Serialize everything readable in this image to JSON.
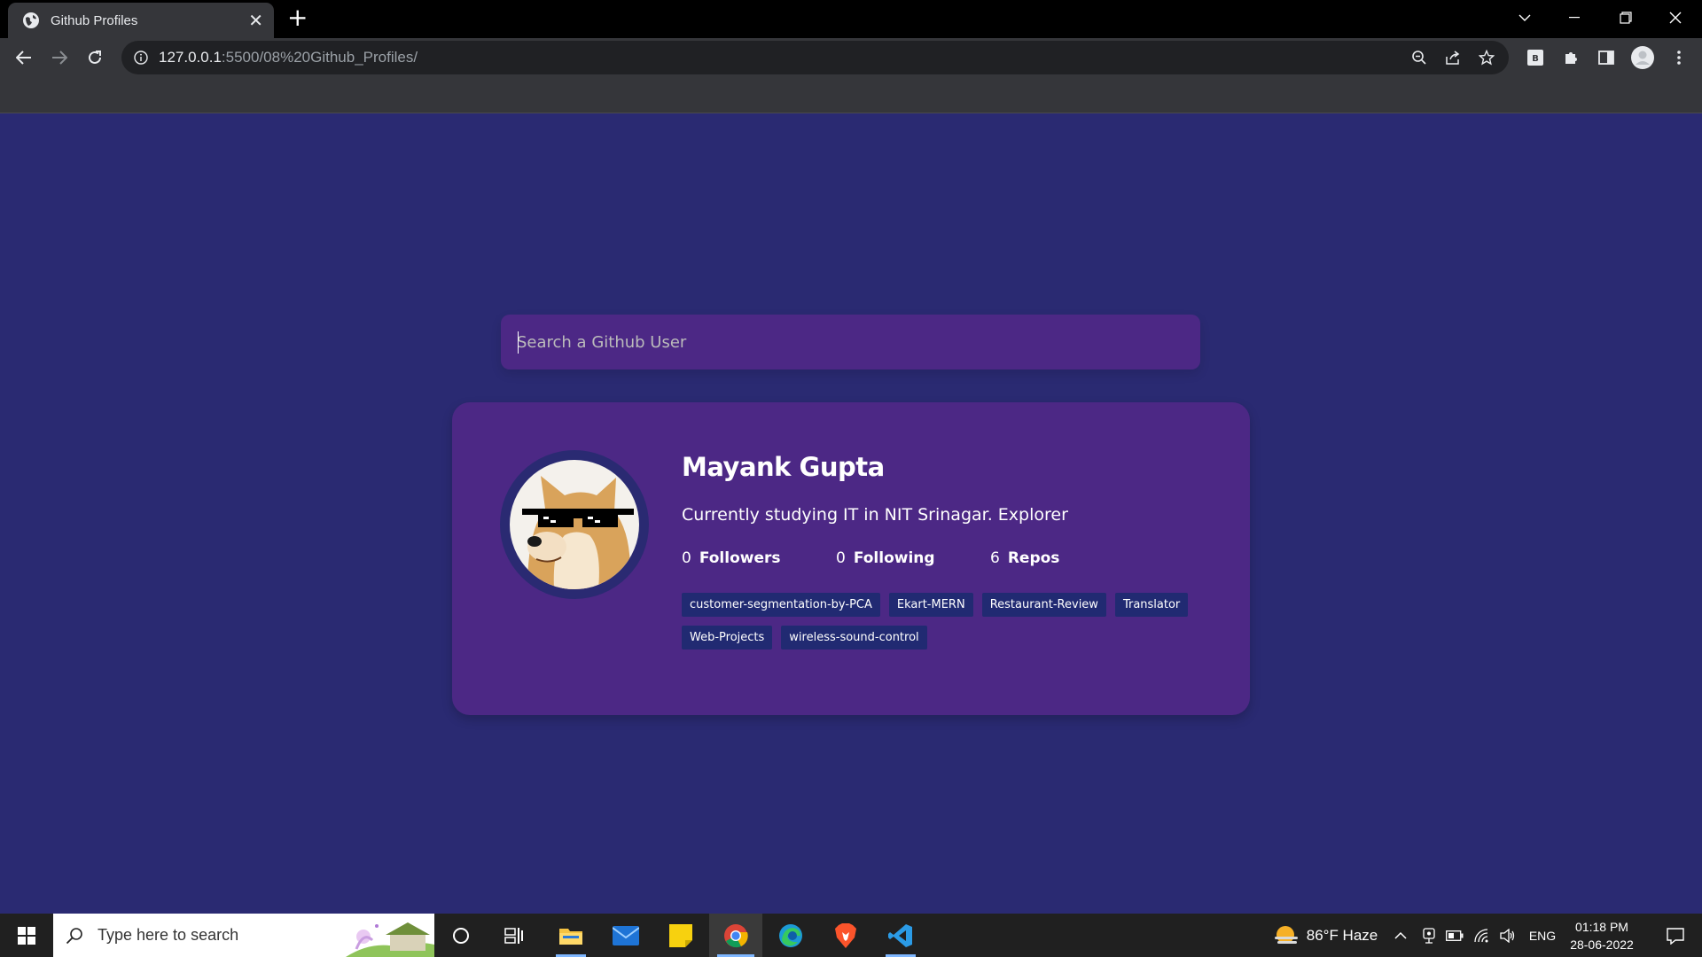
{
  "browser": {
    "tab_title": "Github Profiles",
    "url_host": "127.0.0.1",
    "url_rest": ":5500/08%20Github_Profiles/"
  },
  "search": {
    "placeholder": "Search a Github User"
  },
  "profile": {
    "name": "Mayank Gupta",
    "bio": "Currently studying IT in NIT Srinagar. Explorer",
    "followers_count": "0",
    "followers_label": "Followers",
    "following_count": "0",
    "following_label": "Following",
    "repos_count": "6",
    "repos_label": "Repos",
    "repos": [
      "customer-segmentation-by-PCA",
      "Ekart-MERN",
      "Restaurant-Review",
      "Translator",
      "Web-Projects",
      "wireless-sound-control"
    ]
  },
  "taskbar": {
    "search_placeholder": "Type here to search",
    "weather": "86°F  Haze",
    "language": "ENG",
    "time": "01:18 PM",
    "date": "28-06-2022"
  },
  "colors": {
    "page_background": "#2a2a72",
    "card_background": "#4c2885",
    "repo_tag_background": "#212a72"
  }
}
